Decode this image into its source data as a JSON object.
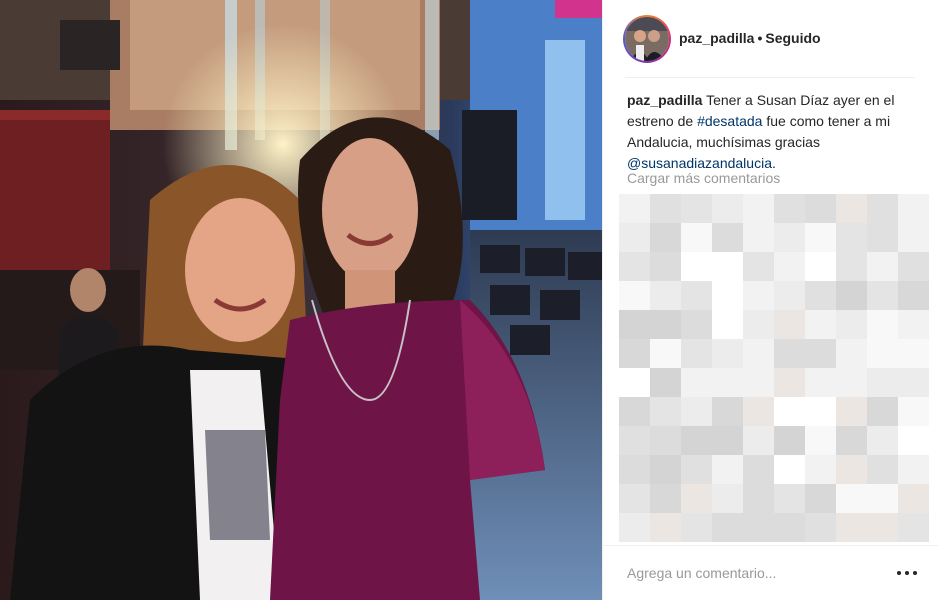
{
  "post": {
    "username": "paz_padilla",
    "separator": "•",
    "follow_status": "Seguido",
    "caption": {
      "username": "paz_padilla",
      "text_1": " Tener a Susan Díaz ayer en el estreno de ",
      "hashtag": "#desatada",
      "text_2": " fue como tener a mi Andalucia, muchísimas gracias ",
      "mention": "@susanadiazandalucia",
      "text_3": "."
    },
    "load_more_label": "Cargar más comentarios",
    "comment_placeholder": "Agrega un comentario..."
  },
  "icons": {
    "more": "more-options-icon",
    "avatar": "profile-avatar"
  }
}
